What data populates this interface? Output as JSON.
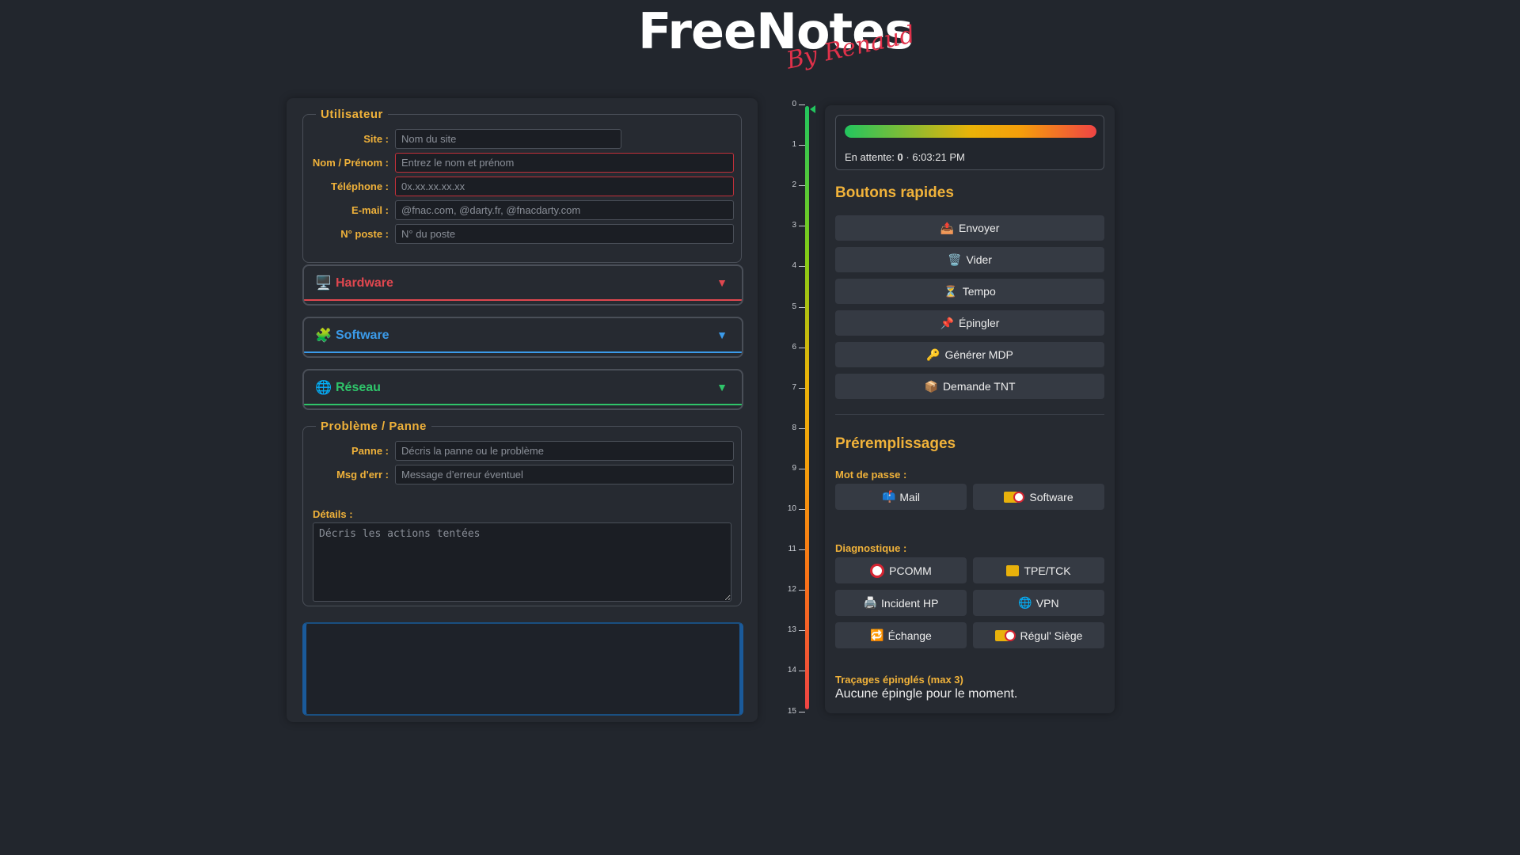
{
  "logo": {
    "brand": "FreeNotes",
    "by": "By Renaud"
  },
  "user_section": {
    "legend": "Utilisateur",
    "fields": [
      {
        "label": "Site :",
        "placeholder": "Nom du site",
        "value": ""
      },
      {
        "label": "Nom / Prénom :",
        "placeholder": "Entrez le nom et prénom",
        "value": "",
        "error": true
      },
      {
        "label": "Téléphone :",
        "placeholder": "0x.xx.xx.xx.xx",
        "value": "",
        "error": true
      },
      {
        "label": "E-mail :",
        "placeholder": "@fnac.com, @darty.fr, @fnacdarty.com",
        "value": ""
      },
      {
        "label": "N° poste :",
        "placeholder": "N° du poste",
        "value": ""
      }
    ]
  },
  "accordions": [
    {
      "icon": "🖥️",
      "title": "Hardware",
      "chevron": "▼",
      "color": "#e0474f"
    },
    {
      "icon": "🧩",
      "title": "Software",
      "chevron": "▼",
      "color": "#3b9bea"
    },
    {
      "icon": "🌐",
      "title": "Réseau",
      "chevron": "▼",
      "color": "#2fc46a"
    }
  ],
  "problem_section": {
    "legend": "Problème / Panne",
    "fields": [
      {
        "label": "Panne :",
        "placeholder": "Décris la panne ou le problème",
        "value": ""
      },
      {
        "label": "Msg d'err :",
        "placeholder": "Message d’erreur éventuel",
        "value": ""
      }
    ],
    "details_label": "Détails :",
    "details_placeholder": "Décris les actions tentées"
  },
  "timeline": {
    "ticks": [
      "0",
      "1",
      "2",
      "3",
      "4",
      "5",
      "6",
      "7",
      "8",
      "9",
      "10",
      "11",
      "12",
      "13",
      "14",
      "15"
    ],
    "current": 0
  },
  "status": {
    "progress": 1.0,
    "waiting_label": "En attente:",
    "waiting_count": "0",
    "separator": "·",
    "time": "6:03:21 PM"
  },
  "quick_buttons": {
    "title": "Boutons rapides",
    "items": [
      {
        "icon": "📤",
        "label": "Envoyer"
      },
      {
        "icon": "🗑️",
        "label": "Vider"
      },
      {
        "icon": "⏳",
        "label": "Tempo"
      },
      {
        "icon": "📌",
        "label": "Épingler"
      },
      {
        "icon": "🔑",
        "label": "Générer MDP"
      },
      {
        "icon": "📦",
        "label": "Demande TNT"
      }
    ]
  },
  "prefills": {
    "title": "Préremplissages",
    "password_label": "Mot de passe :",
    "password_buttons": [
      {
        "icon": "📫",
        "label": "Mail"
      },
      {
        "icon": "fnac-darty-logo-icon",
        "label": "Software"
      }
    ],
    "diag_label": "Diagnostique :",
    "diag_buttons": [
      {
        "icon": "darty-logo-icon",
        "label": "PCOMM"
      },
      {
        "icon": "ticket-icon",
        "label": "TPE/TCK"
      },
      {
        "icon": "🖨️",
        "label": "Incident HP"
      },
      {
        "icon": "🌐",
        "label": "VPN"
      },
      {
        "icon": "🔁",
        "label": "Échange"
      },
      {
        "icon": "fnac-darty-logo-icon",
        "label": "Régul' Siège"
      }
    ]
  },
  "pins": {
    "title": "Traçages épinglés (max 3)",
    "empty": "Aucune épingle pour le moment."
  }
}
